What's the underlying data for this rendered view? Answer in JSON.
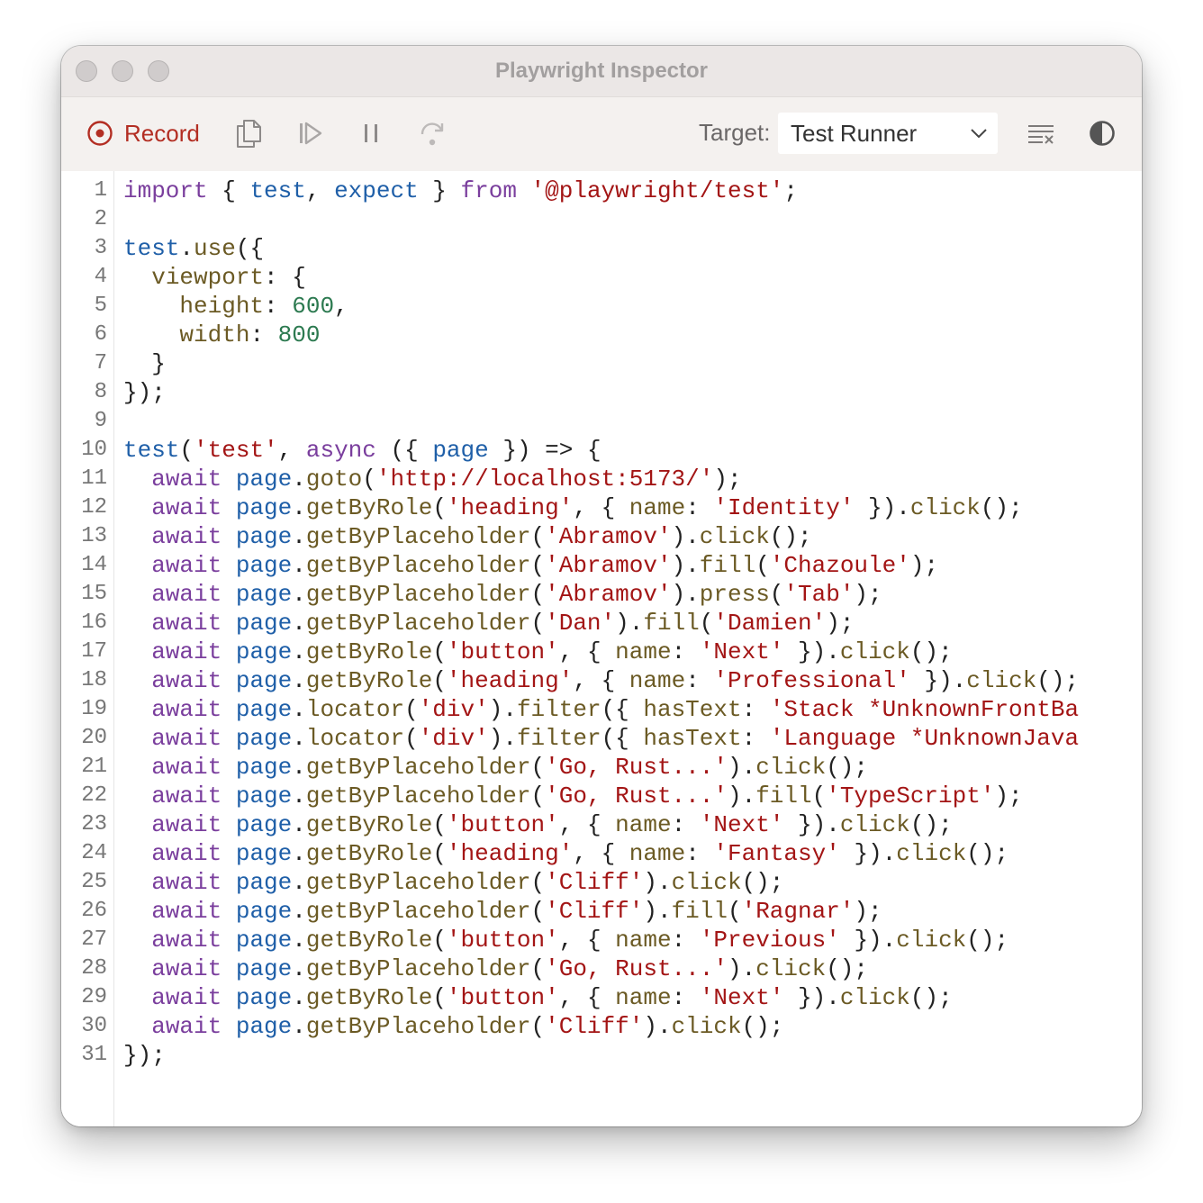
{
  "window": {
    "title": "Playwright Inspector"
  },
  "toolbar": {
    "record_label": "Record",
    "target_label": "Target:",
    "target_value": "Test Runner"
  },
  "icons": [
    "record-icon",
    "copy-icon",
    "resume-icon",
    "pause-icon",
    "step-over-icon",
    "chevron-down-icon",
    "clear-icon",
    "theme-toggle-icon"
  ],
  "colors": {
    "record_accent": "#b32e23",
    "keyword": "#7a3e9d",
    "identifier": "#1f5fa8",
    "string": "#a31515",
    "number": "#2c7a50",
    "function": "#6b5a24"
  },
  "code": {
    "lines": [
      [
        [
          "kw",
          "import"
        ],
        [
          "p",
          " { "
        ],
        [
          "id",
          "test"
        ],
        [
          "p",
          ", "
        ],
        [
          "id",
          "expect"
        ],
        [
          "p",
          " } "
        ],
        [
          "kw",
          "from"
        ],
        [
          "p",
          " "
        ],
        [
          "str",
          "'@playwright/test'"
        ],
        [
          "p",
          ";"
        ]
      ],
      [],
      [
        [
          "id",
          "test"
        ],
        [
          "p",
          "."
        ],
        [
          "fn",
          "use"
        ],
        [
          "p",
          "({"
        ]
      ],
      [
        [
          "p",
          "  "
        ],
        [
          "pr",
          "viewport"
        ],
        [
          "p",
          ": {"
        ]
      ],
      [
        [
          "p",
          "    "
        ],
        [
          "pr",
          "height"
        ],
        [
          "p",
          ": "
        ],
        [
          "num",
          "600"
        ],
        [
          "p",
          ","
        ]
      ],
      [
        [
          "p",
          "    "
        ],
        [
          "pr",
          "width"
        ],
        [
          "p",
          ": "
        ],
        [
          "num",
          "800"
        ]
      ],
      [
        [
          "p",
          "  }"
        ]
      ],
      [
        [
          "p",
          "});"
        ]
      ],
      [],
      [
        [
          "id",
          "test"
        ],
        [
          "p",
          "("
        ],
        [
          "str",
          "'test'"
        ],
        [
          "p",
          ", "
        ],
        [
          "kw",
          "async"
        ],
        [
          "p",
          " ({ "
        ],
        [
          "id",
          "page"
        ],
        [
          "p",
          " }) => {"
        ]
      ],
      [
        [
          "p",
          "  "
        ],
        [
          "kw",
          "await"
        ],
        [
          "p",
          " "
        ],
        [
          "id",
          "page"
        ],
        [
          "p",
          "."
        ],
        [
          "fn",
          "goto"
        ],
        [
          "p",
          "("
        ],
        [
          "str",
          "'http://localhost:5173/'"
        ],
        [
          "p",
          ");"
        ]
      ],
      [
        [
          "p",
          "  "
        ],
        [
          "kw",
          "await"
        ],
        [
          "p",
          " "
        ],
        [
          "id",
          "page"
        ],
        [
          "p",
          "."
        ],
        [
          "fn",
          "getByRole"
        ],
        [
          "p",
          "("
        ],
        [
          "str",
          "'heading'"
        ],
        [
          "p",
          ", { "
        ],
        [
          "pr",
          "name"
        ],
        [
          "p",
          ": "
        ],
        [
          "str",
          "'Identity'"
        ],
        [
          "p",
          " })."
        ],
        [
          "fn",
          "click"
        ],
        [
          "p",
          "();"
        ]
      ],
      [
        [
          "p",
          "  "
        ],
        [
          "kw",
          "await"
        ],
        [
          "p",
          " "
        ],
        [
          "id",
          "page"
        ],
        [
          "p",
          "."
        ],
        [
          "fn",
          "getByPlaceholder"
        ],
        [
          "p",
          "("
        ],
        [
          "str",
          "'Abramov'"
        ],
        [
          "p",
          ")."
        ],
        [
          "fn",
          "click"
        ],
        [
          "p",
          "();"
        ]
      ],
      [
        [
          "p",
          "  "
        ],
        [
          "kw",
          "await"
        ],
        [
          "p",
          " "
        ],
        [
          "id",
          "page"
        ],
        [
          "p",
          "."
        ],
        [
          "fn",
          "getByPlaceholder"
        ],
        [
          "p",
          "("
        ],
        [
          "str",
          "'Abramov'"
        ],
        [
          "p",
          ")."
        ],
        [
          "fn",
          "fill"
        ],
        [
          "p",
          "("
        ],
        [
          "str",
          "'Chazoule'"
        ],
        [
          "p",
          ");"
        ]
      ],
      [
        [
          "p",
          "  "
        ],
        [
          "kw",
          "await"
        ],
        [
          "p",
          " "
        ],
        [
          "id",
          "page"
        ],
        [
          "p",
          "."
        ],
        [
          "fn",
          "getByPlaceholder"
        ],
        [
          "p",
          "("
        ],
        [
          "str",
          "'Abramov'"
        ],
        [
          "p",
          ")."
        ],
        [
          "fn",
          "press"
        ],
        [
          "p",
          "("
        ],
        [
          "str",
          "'Tab'"
        ],
        [
          "p",
          ");"
        ]
      ],
      [
        [
          "p",
          "  "
        ],
        [
          "kw",
          "await"
        ],
        [
          "p",
          " "
        ],
        [
          "id",
          "page"
        ],
        [
          "p",
          "."
        ],
        [
          "fn",
          "getByPlaceholder"
        ],
        [
          "p",
          "("
        ],
        [
          "str",
          "'Dan'"
        ],
        [
          "p",
          ")."
        ],
        [
          "fn",
          "fill"
        ],
        [
          "p",
          "("
        ],
        [
          "str",
          "'Damien'"
        ],
        [
          "p",
          ");"
        ]
      ],
      [
        [
          "p",
          "  "
        ],
        [
          "kw",
          "await"
        ],
        [
          "p",
          " "
        ],
        [
          "id",
          "page"
        ],
        [
          "p",
          "."
        ],
        [
          "fn",
          "getByRole"
        ],
        [
          "p",
          "("
        ],
        [
          "str",
          "'button'"
        ],
        [
          "p",
          ", { "
        ],
        [
          "pr",
          "name"
        ],
        [
          "p",
          ": "
        ],
        [
          "str",
          "'Next'"
        ],
        [
          "p",
          " })."
        ],
        [
          "fn",
          "click"
        ],
        [
          "p",
          "();"
        ]
      ],
      [
        [
          "p",
          "  "
        ],
        [
          "kw",
          "await"
        ],
        [
          "p",
          " "
        ],
        [
          "id",
          "page"
        ],
        [
          "p",
          "."
        ],
        [
          "fn",
          "getByRole"
        ],
        [
          "p",
          "("
        ],
        [
          "str",
          "'heading'"
        ],
        [
          "p",
          ", { "
        ],
        [
          "pr",
          "name"
        ],
        [
          "p",
          ": "
        ],
        [
          "str",
          "'Professional'"
        ],
        [
          "p",
          " })."
        ],
        [
          "fn",
          "click"
        ],
        [
          "p",
          "();"
        ]
      ],
      [
        [
          "p",
          "  "
        ],
        [
          "kw",
          "await"
        ],
        [
          "p",
          " "
        ],
        [
          "id",
          "page"
        ],
        [
          "p",
          "."
        ],
        [
          "fn",
          "locator"
        ],
        [
          "p",
          "("
        ],
        [
          "str",
          "'div'"
        ],
        [
          "p",
          ")."
        ],
        [
          "fn",
          "filter"
        ],
        [
          "p",
          "({ "
        ],
        [
          "pr",
          "hasText"
        ],
        [
          "p",
          ": "
        ],
        [
          "str",
          "'Stack *UnknownFrontBa"
        ]
      ],
      [
        [
          "p",
          "  "
        ],
        [
          "kw",
          "await"
        ],
        [
          "p",
          " "
        ],
        [
          "id",
          "page"
        ],
        [
          "p",
          "."
        ],
        [
          "fn",
          "locator"
        ],
        [
          "p",
          "("
        ],
        [
          "str",
          "'div'"
        ],
        [
          "p",
          ")."
        ],
        [
          "fn",
          "filter"
        ],
        [
          "p",
          "({ "
        ],
        [
          "pr",
          "hasText"
        ],
        [
          "p",
          ": "
        ],
        [
          "str",
          "'Language *UnknownJava"
        ]
      ],
      [
        [
          "p",
          "  "
        ],
        [
          "kw",
          "await"
        ],
        [
          "p",
          " "
        ],
        [
          "id",
          "page"
        ],
        [
          "p",
          "."
        ],
        [
          "fn",
          "getByPlaceholder"
        ],
        [
          "p",
          "("
        ],
        [
          "str",
          "'Go, Rust...'"
        ],
        [
          "p",
          ")."
        ],
        [
          "fn",
          "click"
        ],
        [
          "p",
          "();"
        ]
      ],
      [
        [
          "p",
          "  "
        ],
        [
          "kw",
          "await"
        ],
        [
          "p",
          " "
        ],
        [
          "id",
          "page"
        ],
        [
          "p",
          "."
        ],
        [
          "fn",
          "getByPlaceholder"
        ],
        [
          "p",
          "("
        ],
        [
          "str",
          "'Go, Rust...'"
        ],
        [
          "p",
          ")."
        ],
        [
          "fn",
          "fill"
        ],
        [
          "p",
          "("
        ],
        [
          "str",
          "'TypeScript'"
        ],
        [
          "p",
          ");"
        ]
      ],
      [
        [
          "p",
          "  "
        ],
        [
          "kw",
          "await"
        ],
        [
          "p",
          " "
        ],
        [
          "id",
          "page"
        ],
        [
          "p",
          "."
        ],
        [
          "fn",
          "getByRole"
        ],
        [
          "p",
          "("
        ],
        [
          "str",
          "'button'"
        ],
        [
          "p",
          ", { "
        ],
        [
          "pr",
          "name"
        ],
        [
          "p",
          ": "
        ],
        [
          "str",
          "'Next'"
        ],
        [
          "p",
          " })."
        ],
        [
          "fn",
          "click"
        ],
        [
          "p",
          "();"
        ]
      ],
      [
        [
          "p",
          "  "
        ],
        [
          "kw",
          "await"
        ],
        [
          "p",
          " "
        ],
        [
          "id",
          "page"
        ],
        [
          "p",
          "."
        ],
        [
          "fn",
          "getByRole"
        ],
        [
          "p",
          "("
        ],
        [
          "str",
          "'heading'"
        ],
        [
          "p",
          ", { "
        ],
        [
          "pr",
          "name"
        ],
        [
          "p",
          ": "
        ],
        [
          "str",
          "'Fantasy'"
        ],
        [
          "p",
          " })."
        ],
        [
          "fn",
          "click"
        ],
        [
          "p",
          "();"
        ]
      ],
      [
        [
          "p",
          "  "
        ],
        [
          "kw",
          "await"
        ],
        [
          "p",
          " "
        ],
        [
          "id",
          "page"
        ],
        [
          "p",
          "."
        ],
        [
          "fn",
          "getByPlaceholder"
        ],
        [
          "p",
          "("
        ],
        [
          "str",
          "'Cliff'"
        ],
        [
          "p",
          ")."
        ],
        [
          "fn",
          "click"
        ],
        [
          "p",
          "();"
        ]
      ],
      [
        [
          "p",
          "  "
        ],
        [
          "kw",
          "await"
        ],
        [
          "p",
          " "
        ],
        [
          "id",
          "page"
        ],
        [
          "p",
          "."
        ],
        [
          "fn",
          "getByPlaceholder"
        ],
        [
          "p",
          "("
        ],
        [
          "str",
          "'Cliff'"
        ],
        [
          "p",
          ")."
        ],
        [
          "fn",
          "fill"
        ],
        [
          "p",
          "("
        ],
        [
          "str",
          "'Ragnar'"
        ],
        [
          "p",
          ");"
        ]
      ],
      [
        [
          "p",
          "  "
        ],
        [
          "kw",
          "await"
        ],
        [
          "p",
          " "
        ],
        [
          "id",
          "page"
        ],
        [
          "p",
          "."
        ],
        [
          "fn",
          "getByRole"
        ],
        [
          "p",
          "("
        ],
        [
          "str",
          "'button'"
        ],
        [
          "p",
          ", { "
        ],
        [
          "pr",
          "name"
        ],
        [
          "p",
          ": "
        ],
        [
          "str",
          "'Previous'"
        ],
        [
          "p",
          " })."
        ],
        [
          "fn",
          "click"
        ],
        [
          "p",
          "();"
        ]
      ],
      [
        [
          "p",
          "  "
        ],
        [
          "kw",
          "await"
        ],
        [
          "p",
          " "
        ],
        [
          "id",
          "page"
        ],
        [
          "p",
          "."
        ],
        [
          "fn",
          "getByPlaceholder"
        ],
        [
          "p",
          "("
        ],
        [
          "str",
          "'Go, Rust...'"
        ],
        [
          "p",
          ")."
        ],
        [
          "fn",
          "click"
        ],
        [
          "p",
          "();"
        ]
      ],
      [
        [
          "p",
          "  "
        ],
        [
          "kw",
          "await"
        ],
        [
          "p",
          " "
        ],
        [
          "id",
          "page"
        ],
        [
          "p",
          "."
        ],
        [
          "fn",
          "getByRole"
        ],
        [
          "p",
          "("
        ],
        [
          "str",
          "'button'"
        ],
        [
          "p",
          ", { "
        ],
        [
          "pr",
          "name"
        ],
        [
          "p",
          ": "
        ],
        [
          "str",
          "'Next'"
        ],
        [
          "p",
          " })."
        ],
        [
          "fn",
          "click"
        ],
        [
          "p",
          "();"
        ]
      ],
      [
        [
          "p",
          "  "
        ],
        [
          "kw",
          "await"
        ],
        [
          "p",
          " "
        ],
        [
          "id",
          "page"
        ],
        [
          "p",
          "."
        ],
        [
          "fn",
          "getByPlaceholder"
        ],
        [
          "p",
          "("
        ],
        [
          "str",
          "'Cliff'"
        ],
        [
          "p",
          ")."
        ],
        [
          "fn",
          "click"
        ],
        [
          "p",
          "();"
        ]
      ],
      [
        [
          "p",
          "});"
        ]
      ]
    ]
  }
}
